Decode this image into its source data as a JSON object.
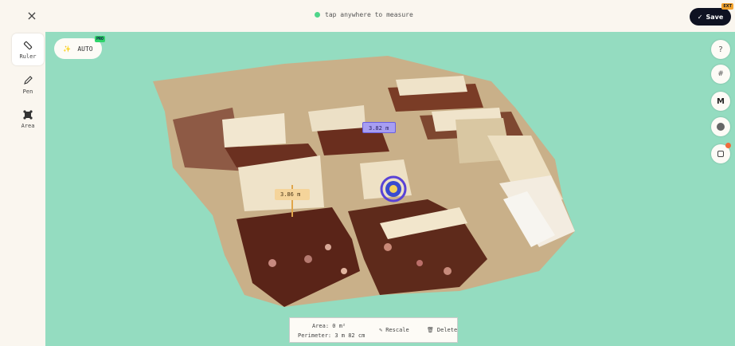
{
  "topbar": {
    "close_label": "×",
    "hint": "tap anywhere to measure",
    "save_label": "Save",
    "save_badge": "EXT"
  },
  "tools": [
    {
      "label": "Ruler",
      "icon": "ruler-icon",
      "active": true
    },
    {
      "label": "Pen",
      "icon": "pen-icon",
      "active": false
    },
    {
      "label": "Area",
      "icon": "area-icon",
      "active": false
    }
  ],
  "auto": {
    "label": "AUTO",
    "badge": "PRO"
  },
  "right_controls": {
    "help_label": "?",
    "map_label": "M"
  },
  "measurements": {
    "purple": "3.82 m",
    "amber": "3.86 m"
  },
  "info": {
    "area": "Area: 0 m²",
    "perimeter": "Perimeter: 3 m 82 cm",
    "rescale_label": "Rescale",
    "delete_label": "Delete"
  },
  "colors": {
    "viewport_bg": "#94dcc0",
    "accent_dark": "#0f1222",
    "status_dot": "#4fd58a",
    "purple_tag": "#a79ef2",
    "amber_tag": "#f5d49a"
  }
}
